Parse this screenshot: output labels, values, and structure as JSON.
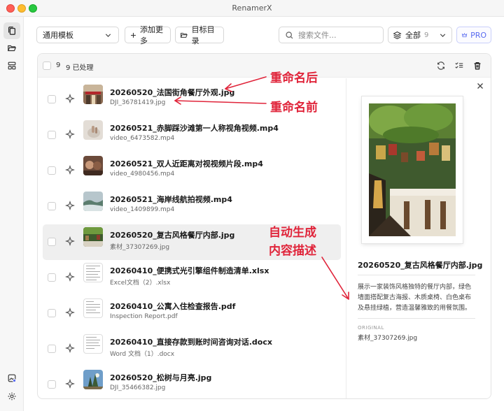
{
  "window": {
    "title": "RenamerX"
  },
  "toolbar": {
    "template": "通用模板",
    "add_more": "添加更多",
    "target_dir": "目标目录",
    "search_placeholder": "搜索文件...",
    "filter_label": "全部",
    "filter_count": "9",
    "pro_label": "PRO"
  },
  "list_header": {
    "count": "9",
    "processed": "9 已处理"
  },
  "files": [
    {
      "new_name": "20260520_法国街角餐厅外观.jpg",
      "original_name": "DJI_36781419.jpg"
    },
    {
      "new_name": "20260521_赤脚踩沙滩第一人称视角视频.mp4",
      "original_name": "video_6473582.mp4"
    },
    {
      "new_name": "20260521_双人近距离对视视频片段.mp4",
      "original_name": "video_4980456.mp4"
    },
    {
      "new_name": "20260521_海岸线航拍视频.mp4",
      "original_name": "video_1409899.mp4"
    },
    {
      "new_name": "20260520_复古风格餐厅内部.jpg",
      "original_name": "素材_37307269.jpg"
    },
    {
      "new_name": "20260410_便携式光引擎组件制造清单.xlsx",
      "original_name": "Excel文档（2）.xlsx"
    },
    {
      "new_name": "20260410_公寓入住检查报告.pdf",
      "original_name": "Inspection Report.pdf"
    },
    {
      "new_name": "20260410_直接存款到账时间咨询对话.docx",
      "original_name": "Word 文档（1）.docx"
    },
    {
      "new_name": "20260520_松树与月亮.jpg",
      "original_name": "DJI_35466382.jpg"
    }
  ],
  "detail": {
    "name": "20260520_复古风格餐厅内部.jpg",
    "description": "展示一家装饰风格独特的餐厅内部，绿色墙面搭配复古海报、木质桌椅、白色桌布及悬挂绿植，营造温馨雅致的用餐氛围。",
    "original_label": "ORIGINAL",
    "original_value": "素材_37307269.jpg"
  },
  "annotations": {
    "after_rename": "重命名后",
    "before_rename": "重命名前",
    "auto_desc_1": "自动生成",
    "auto_desc_2": "内容描述"
  },
  "colors": {
    "annotation": "#e0243a",
    "pro_accent": "#5a6cf0",
    "selected_row": "#efefef"
  }
}
